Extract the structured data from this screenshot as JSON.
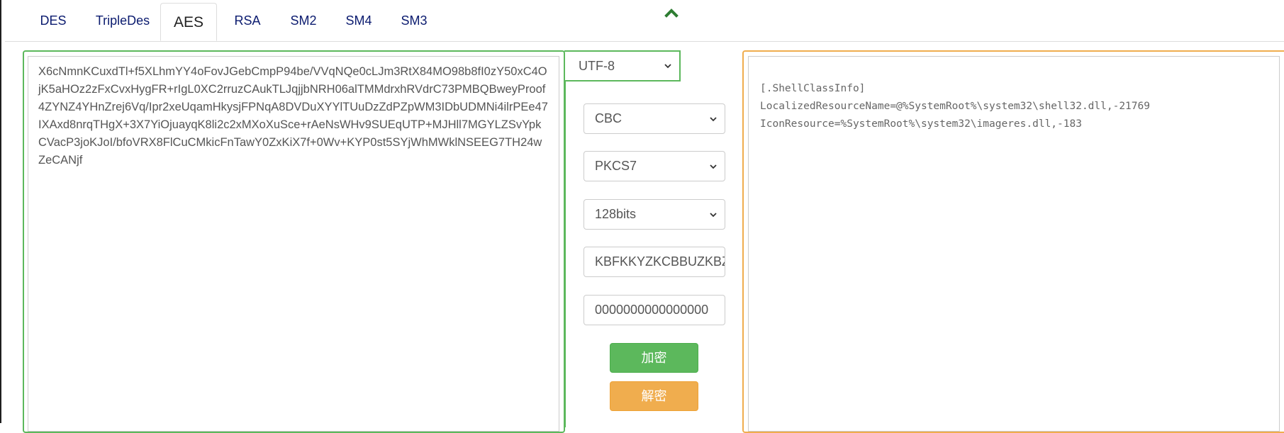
{
  "tabs": [
    {
      "label": "DES",
      "active": false
    },
    {
      "label": "TripleDes",
      "active": false
    },
    {
      "label": "AES",
      "active": true
    },
    {
      "label": "RSA",
      "active": false
    },
    {
      "label": "SM2",
      "active": false
    },
    {
      "label": "SM4",
      "active": false
    },
    {
      "label": "SM3",
      "active": false
    }
  ],
  "collapse_icon": "chevron-up-icon",
  "input": {
    "text": "X6cNmnKCuxdTl+f5XLhmYY4oFovJGebCmpP94be/VVqNQe0cLJm3RtX84MO98b8fI0zY50xC4OjK5aHOz2zFxCvxHygFR+rIgL0XC2rruzCAukTLJqjjbNRH06alTMMdrxhRVdrC73PMBQBweyProof4ZYNZ4YHnZrej6Vq/Ipr2xeUqamHkysjFPNqA8DVDuXYYlTUuDzZdPZpWM3IDbUDMNi4ilrPEe47IXAxd8nrqTHgX+3X7YiOjuayqK8li2c2xMXoXuSce+rAeNsWHv9SUEqUTP+MJHll7MGYLZSvYpkCVacP3joKJoI/bfoVRX8FlCuCMkicFnTawY0ZxKiX7f+0Wv+KYP0st5SYjWhMWklNSEEG7TH24wZeCANjf"
  },
  "settings": {
    "encoding": "UTF-8",
    "mode": "CBC",
    "padding": "PKCS7",
    "key_size": "128bits",
    "key": "KBFKKYZKCBBUZKBZ",
    "iv": "0000000000000000"
  },
  "buttons": {
    "encrypt": "加密",
    "decrypt": "解密"
  },
  "output": {
    "text": "[.ShellClassInfo]\nLocalizedResourceName=@%SystemRoot%\\system32\\shell32.dll,-21769\nIconResource=%SystemRoot%\\system32\\imageres.dll,-183"
  },
  "colors": {
    "success": "#5cb85c",
    "warning": "#f0ad4e",
    "tab_text": "#0b1b6f"
  }
}
